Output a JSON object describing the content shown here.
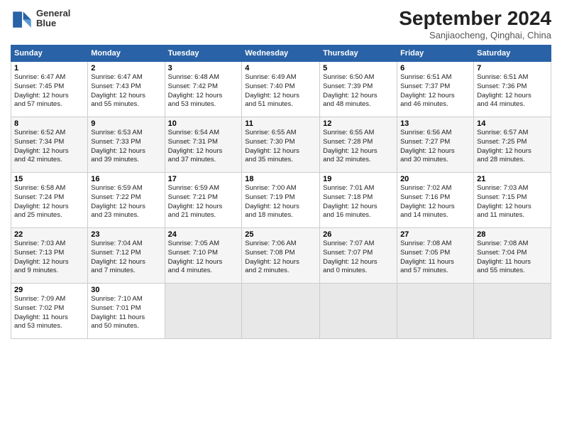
{
  "header": {
    "logo_line1": "General",
    "logo_line2": "Blue",
    "month": "September 2024",
    "location": "Sanjiaocheng, Qinghai, China"
  },
  "days_of_week": [
    "Sunday",
    "Monday",
    "Tuesday",
    "Wednesday",
    "Thursday",
    "Friday",
    "Saturday"
  ],
  "weeks": [
    [
      {
        "day": "1",
        "rise": "6:47 AM",
        "set": "7:45 PM",
        "daylight": "12 hours and 57 minutes."
      },
      {
        "day": "2",
        "rise": "6:47 AM",
        "set": "7:43 PM",
        "daylight": "12 hours and 55 minutes."
      },
      {
        "day": "3",
        "rise": "6:48 AM",
        "set": "7:42 PM",
        "daylight": "12 hours and 53 minutes."
      },
      {
        "day": "4",
        "rise": "6:49 AM",
        "set": "7:40 PM",
        "daylight": "12 hours and 51 minutes."
      },
      {
        "day": "5",
        "rise": "6:50 AM",
        "set": "7:39 PM",
        "daylight": "12 hours and 48 minutes."
      },
      {
        "day": "6",
        "rise": "6:51 AM",
        "set": "7:37 PM",
        "daylight": "12 hours and 46 minutes."
      },
      {
        "day": "7",
        "rise": "6:51 AM",
        "set": "7:36 PM",
        "daylight": "12 hours and 44 minutes."
      }
    ],
    [
      {
        "day": "8",
        "rise": "6:52 AM",
        "set": "7:34 PM",
        "daylight": "12 hours and 42 minutes."
      },
      {
        "day": "9",
        "rise": "6:53 AM",
        "set": "7:33 PM",
        "daylight": "12 hours and 39 minutes."
      },
      {
        "day": "10",
        "rise": "6:54 AM",
        "set": "7:31 PM",
        "daylight": "12 hours and 37 minutes."
      },
      {
        "day": "11",
        "rise": "6:55 AM",
        "set": "7:30 PM",
        "daylight": "12 hours and 35 minutes."
      },
      {
        "day": "12",
        "rise": "6:55 AM",
        "set": "7:28 PM",
        "daylight": "12 hours and 32 minutes."
      },
      {
        "day": "13",
        "rise": "6:56 AM",
        "set": "7:27 PM",
        "daylight": "12 hours and 30 minutes."
      },
      {
        "day": "14",
        "rise": "6:57 AM",
        "set": "7:25 PM",
        "daylight": "12 hours and 28 minutes."
      }
    ],
    [
      {
        "day": "15",
        "rise": "6:58 AM",
        "set": "7:24 PM",
        "daylight": "12 hours and 25 minutes."
      },
      {
        "day": "16",
        "rise": "6:59 AM",
        "set": "7:22 PM",
        "daylight": "12 hours and 23 minutes."
      },
      {
        "day": "17",
        "rise": "6:59 AM",
        "set": "7:21 PM",
        "daylight": "12 hours and 21 minutes."
      },
      {
        "day": "18",
        "rise": "7:00 AM",
        "set": "7:19 PM",
        "daylight": "12 hours and 18 minutes."
      },
      {
        "day": "19",
        "rise": "7:01 AM",
        "set": "7:18 PM",
        "daylight": "12 hours and 16 minutes."
      },
      {
        "day": "20",
        "rise": "7:02 AM",
        "set": "7:16 PM",
        "daylight": "12 hours and 14 minutes."
      },
      {
        "day": "21",
        "rise": "7:03 AM",
        "set": "7:15 PM",
        "daylight": "12 hours and 11 minutes."
      }
    ],
    [
      {
        "day": "22",
        "rise": "7:03 AM",
        "set": "7:13 PM",
        "daylight": "12 hours and 9 minutes."
      },
      {
        "day": "23",
        "rise": "7:04 AM",
        "set": "7:12 PM",
        "daylight": "12 hours and 7 minutes."
      },
      {
        "day": "24",
        "rise": "7:05 AM",
        "set": "7:10 PM",
        "daylight": "12 hours and 4 minutes."
      },
      {
        "day": "25",
        "rise": "7:06 AM",
        "set": "7:08 PM",
        "daylight": "12 hours and 2 minutes."
      },
      {
        "day": "26",
        "rise": "7:07 AM",
        "set": "7:07 PM",
        "daylight": "12 hours and 0 minutes."
      },
      {
        "day": "27",
        "rise": "7:08 AM",
        "set": "7:05 PM",
        "daylight": "11 hours and 57 minutes."
      },
      {
        "day": "28",
        "rise": "7:08 AM",
        "set": "7:04 PM",
        "daylight": "11 hours and 55 minutes."
      }
    ],
    [
      {
        "day": "29",
        "rise": "7:09 AM",
        "set": "7:02 PM",
        "daylight": "11 hours and 53 minutes."
      },
      {
        "day": "30",
        "rise": "7:10 AM",
        "set": "7:01 PM",
        "daylight": "11 hours and 50 minutes."
      },
      null,
      null,
      null,
      null,
      null
    ]
  ]
}
